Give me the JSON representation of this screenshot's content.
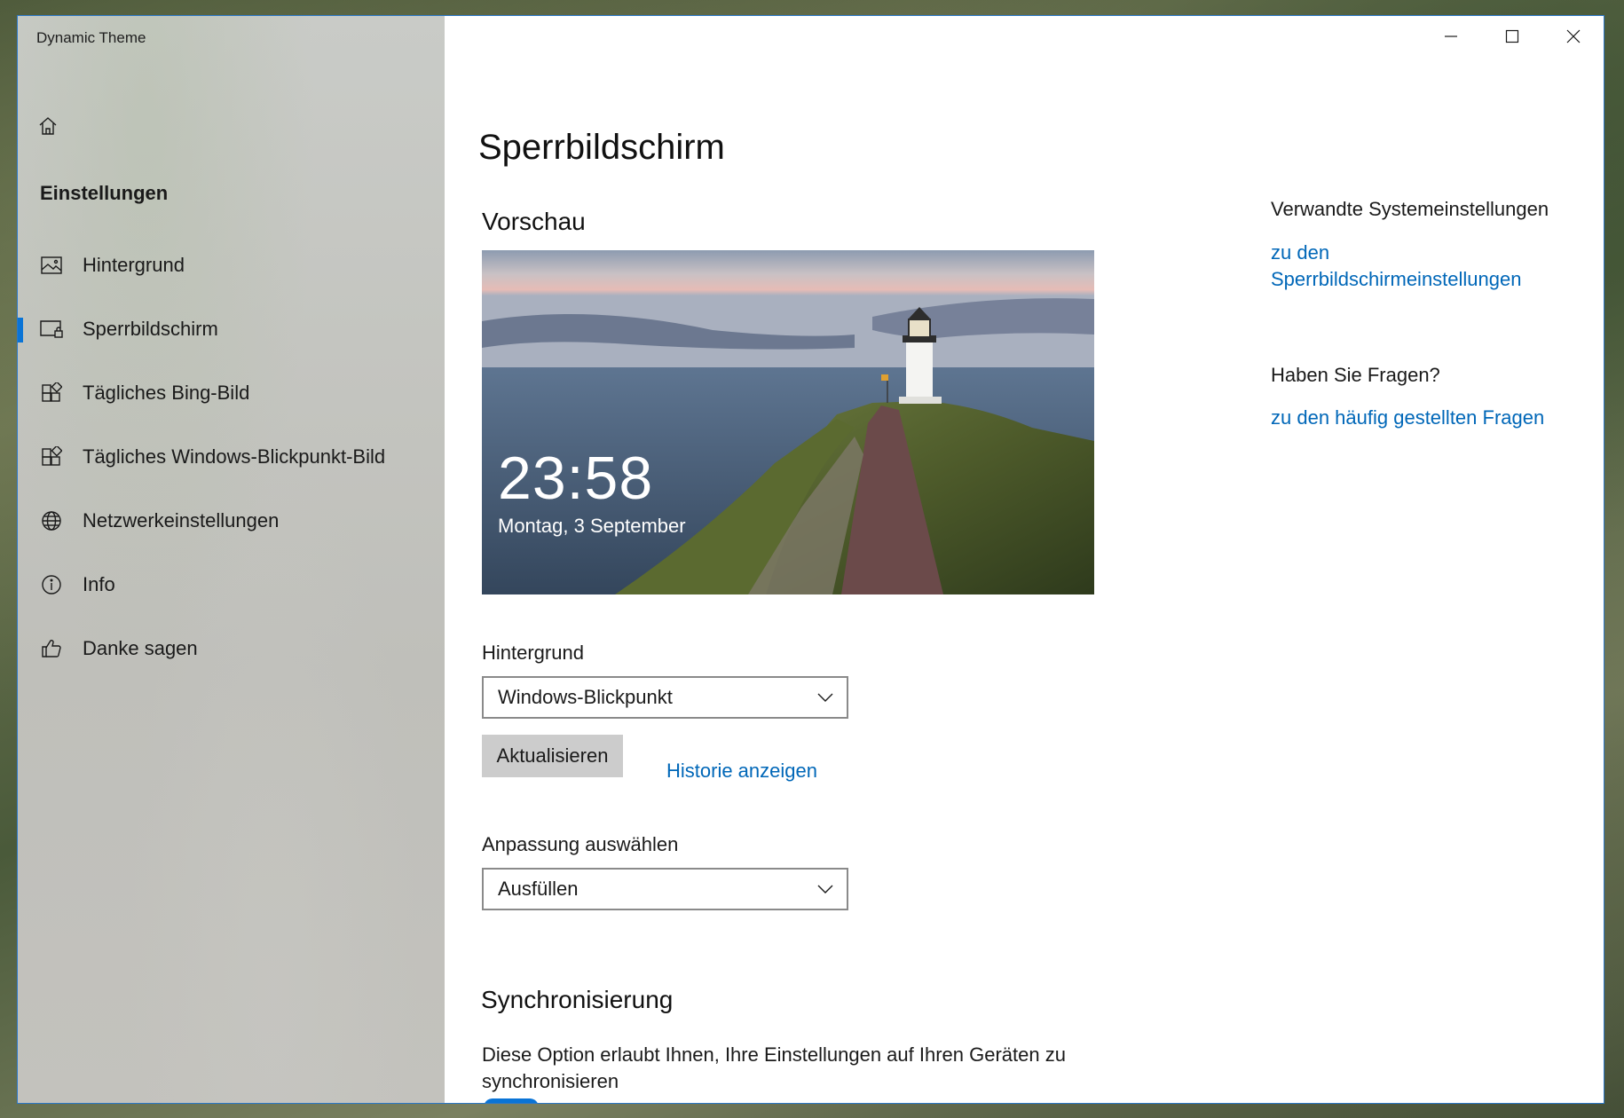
{
  "window": {
    "title": "Dynamic Theme"
  },
  "sidebar": {
    "heading": "Einstellungen",
    "items": [
      {
        "label": "Hintergrund",
        "icon": "image-icon",
        "selected": false
      },
      {
        "label": "Sperrbildschirm",
        "icon": "lock-screen-icon",
        "selected": true
      },
      {
        "label": "Tägliches Bing-Bild",
        "icon": "apps-icon",
        "selected": false
      },
      {
        "label": "Tägliches Windows-Blickpunkt-Bild",
        "icon": "apps-icon",
        "selected": false
      },
      {
        "label": "Netzwerkeinstellungen",
        "icon": "globe-icon",
        "selected": false
      },
      {
        "label": "Info",
        "icon": "info-icon",
        "selected": false
      },
      {
        "label": "Danke sagen",
        "icon": "thumbs-up-icon",
        "selected": false
      }
    ]
  },
  "main": {
    "title": "Sperrbildschirm",
    "preview": {
      "heading": "Vorschau",
      "time": "23:58",
      "date": "Montag, 3 September"
    },
    "background": {
      "label": "Hintergrund",
      "selected": "Windows-Blickpunkt"
    },
    "actions": {
      "refresh": "Aktualisieren",
      "history": "Historie anzeigen"
    },
    "fit": {
      "label": "Anpassung auswählen",
      "selected": "Ausfüllen"
    },
    "sync": {
      "heading": "Synchronisierung",
      "description": "Diese Option erlaubt Ihnen, Ihre Einstellungen auf Ihren Geräten zu synchronisieren"
    }
  },
  "aside": {
    "related_title": "Verwandte Systemeinstellungen",
    "related_link": "zu den Sperrbildschirmeinstellungen",
    "faq_title": "Haben Sie Fragen?",
    "faq_link": "zu den häufig gestellten Fragen"
  },
  "colors": {
    "accent": "#0a74d6",
    "link": "#0067b8",
    "window_border": "#2b78c8"
  }
}
